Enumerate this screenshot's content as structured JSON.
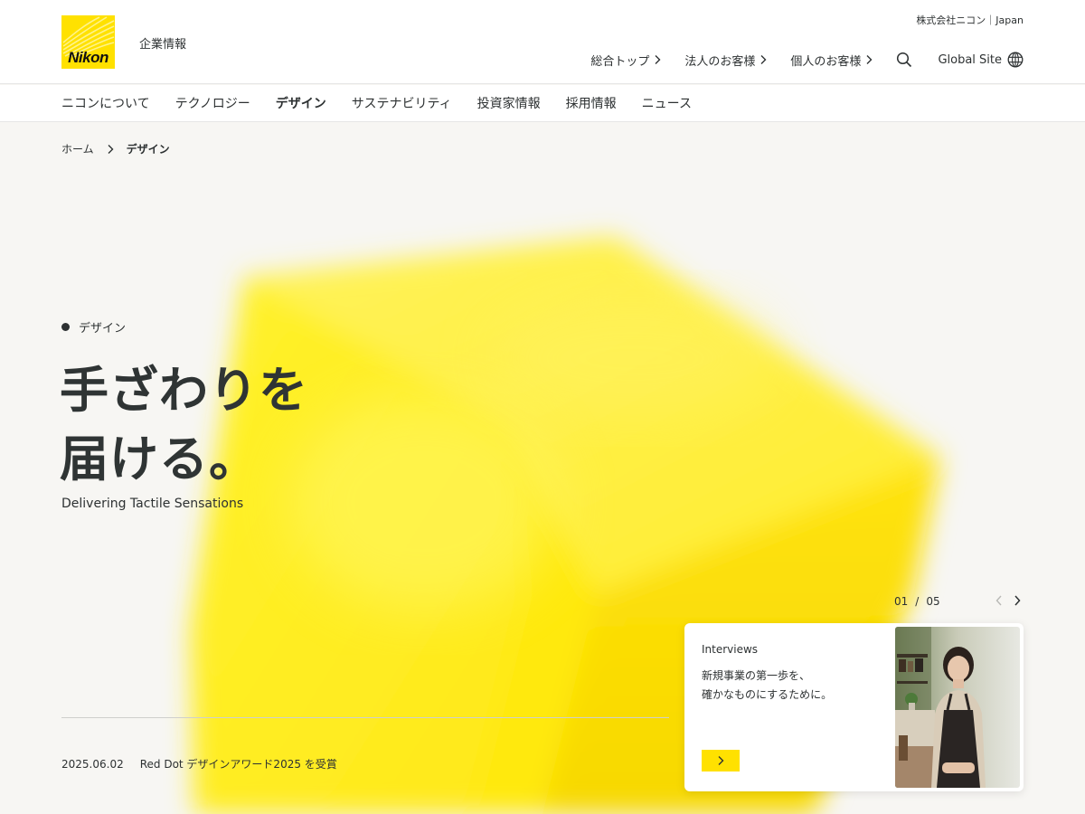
{
  "header": {
    "logo_text": "Nikon",
    "corp_label": "企業情報",
    "region": "株式会社ニコン｜Japan",
    "top_nav": [
      {
        "label": "総合トップ"
      },
      {
        "label": "法人のお客様"
      },
      {
        "label": "個人のお客様"
      }
    ],
    "global_site": "Global Site"
  },
  "main_nav": [
    {
      "label": "ニコンについて"
    },
    {
      "label": "テクノロジー"
    },
    {
      "label": "デザイン",
      "active": true
    },
    {
      "label": "サステナビリティ"
    },
    {
      "label": "投資家情報"
    },
    {
      "label": "採用情報"
    },
    {
      "label": "ニュース"
    }
  ],
  "breadcrumb": {
    "home": "ホーム",
    "current": "デザイン"
  },
  "hero": {
    "section_label": "デザイン",
    "title_line1": "手ざわりを",
    "title_line2": "届ける。",
    "subtitle": "Delivering Tactile Sensations"
  },
  "carousel": {
    "current": "01",
    "separator": "/",
    "total": "05",
    "card": {
      "tag": "Interviews",
      "text_line1": "新規事業の第一歩を、",
      "text_line2": "確かなものにするために。"
    }
  },
  "news": {
    "date": "2025.06.02",
    "title": "Red Dot デザインアワード2025 を受賞"
  },
  "colors": {
    "brand_yellow": "#ffe100",
    "text": "#2d3132",
    "background": "#f7f6f3"
  },
  "icons": {
    "search": "search-icon",
    "globe": "globe-icon",
    "chevron": "chevron-right-icon",
    "prev": "chevron-left-icon"
  }
}
